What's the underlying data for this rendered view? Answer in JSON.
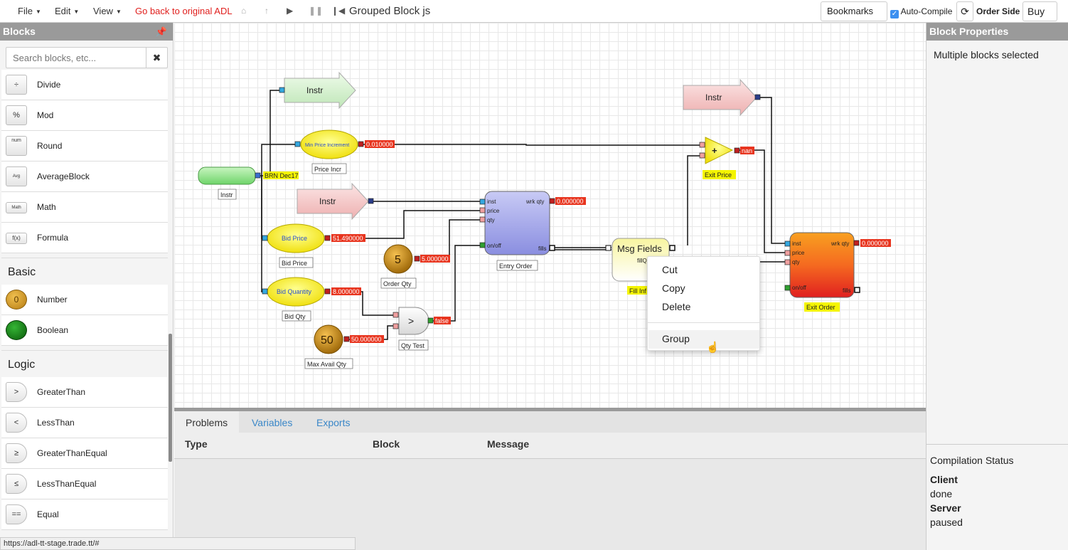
{
  "menubar": {
    "file": "File",
    "edit": "Edit",
    "view": "View",
    "back_link": "Go back to original ADL",
    "doc_title": "Grouped Block js",
    "bookmarks": "Bookmarks",
    "auto_compile": "Auto-Compile",
    "order_side_label": "Order Side",
    "order_side_value": "Buy"
  },
  "blocks_panel": {
    "title": "Blocks",
    "search_placeholder": "Search blocks, etc...",
    "items_top": [
      {
        "label": "Divide",
        "icon": "÷"
      },
      {
        "label": "Mod",
        "icon": "%"
      },
      {
        "label": "Round",
        "icon": "num"
      },
      {
        "label": "AverageBlock",
        "icon": "Avg"
      },
      {
        "label": "Math",
        "icon": "Math"
      },
      {
        "label": "Formula",
        "icon": "f(x)"
      }
    ],
    "basic_title": "Basic",
    "basic_items": [
      {
        "label": "Number",
        "icon": "0"
      },
      {
        "label": "Boolean",
        "icon": ""
      }
    ],
    "logic_title": "Logic",
    "logic_items": [
      {
        "label": "GreaterThan",
        "icon": ">"
      },
      {
        "label": "LessThan",
        "icon": "<"
      },
      {
        "label": "GreaterThanEqual",
        "icon": "≥"
      },
      {
        "label": "LessThanEqual",
        "icon": "≤"
      },
      {
        "label": "Equal",
        "icon": "=="
      }
    ]
  },
  "canvas": {
    "instr_top": "Instr",
    "min_price_increment": "Min Price Increment",
    "min_price_value": "0.010000",
    "price_incr_label": "Price Incr",
    "instr_source_caption": "Instr",
    "brn_label": "BRN Dec17",
    "instr_mid": "Instr",
    "bid_price": "Bid Price",
    "bid_price_value": "51.490000",
    "bid_price_caption": "Bid Price",
    "bid_qty": "Bid Quantity",
    "bid_qty_value": "8.000000",
    "bid_qty_caption": "Bid Qty",
    "order_qty_num": "5",
    "order_qty_value": "5.000000",
    "order_qty_caption": "Order Qty",
    "max_avail_num": "50",
    "max_avail_value": "50.000000",
    "max_avail_caption": "Max Avail Qty",
    "qty_test_symbol": ">",
    "qty_test_value": "false",
    "qty_test_caption": "Qty Test",
    "entry_inst": "inst",
    "entry_price": "price",
    "entry_qty": "qty",
    "entry_onoff": "on/off",
    "entry_wrk": "wrk qty",
    "entry_wrk_value": "0.000000",
    "entry_fills": "fills",
    "entry_caption": "Entry Order",
    "msg_fields": "Msg Fields",
    "msg_fill_q": "fillQ",
    "msg_caption": "Fill Inf",
    "instr_right": "Instr",
    "exit_price_symbol": "+",
    "exit_price_value": "nan",
    "exit_price_caption": "Exit Price",
    "exit_inst": "inst",
    "exit_price": "price",
    "exit_qty": "qty",
    "exit_onoff": "on/off",
    "exit_wrk": "wrk qty",
    "exit_wrk_value": "0.000000",
    "exit_fills": "fills",
    "exit_caption": "Exit Order"
  },
  "context_menu": {
    "cut": "Cut",
    "copy": "Copy",
    "delete": "Delete",
    "group": "Group"
  },
  "bottom_panel": {
    "tabs": [
      "Problems",
      "Variables",
      "Exports"
    ],
    "col_type": "Type",
    "col_block": "Block",
    "col_message": "Message"
  },
  "properties_panel": {
    "title": "Block Properties",
    "message": "Multiple blocks selected",
    "compilation_title": "Compilation Status",
    "client_label": "Client",
    "client_value": "done",
    "server_label": "Server",
    "server_value": "paused"
  },
  "status_url": "https://adl-tt-stage.trade.tt/#",
  "colors": {
    "link_red": "#e0201e",
    "tab_blue": "#3a87c8",
    "value_red": "#e8351f",
    "label_yellow": "#f4f400"
  }
}
